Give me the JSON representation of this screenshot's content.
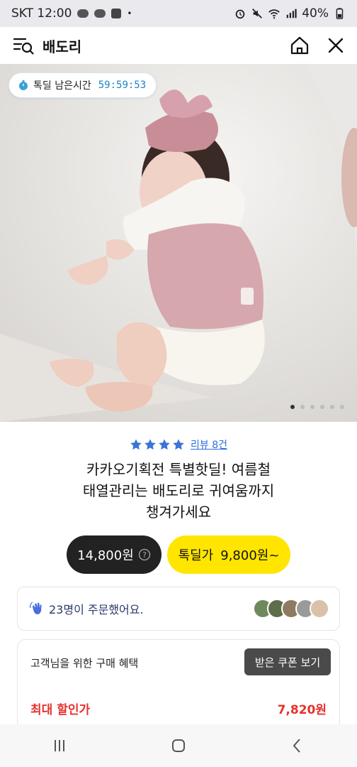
{
  "status_bar": {
    "carrier_time": "SKT 12:00",
    "battery": "40%"
  },
  "header": {
    "title": "배도리"
  },
  "hero": {
    "timer_label": "톡딜 남은시간",
    "timer_value": "59:59:53",
    "page_count": 6,
    "active_page": 1
  },
  "product": {
    "rating_stars": 4,
    "review_link": "리뷰 8건",
    "headline_line1": "카카오기획전 특별핫딜! 여름철",
    "headline_line2": "태열관리는 배도리로 귀여움까지",
    "headline_line3": "챙겨가세요",
    "normal_price": "14,800원",
    "deal_label": "톡딜가",
    "deal_price": "9,800원~"
  },
  "orders": {
    "text": "23명이 주문했어요."
  },
  "benefit": {
    "title": "고객님을 위한 구매 혜택",
    "coupon_button": "받은 쿠폰 보기",
    "max_label": "최대 할인가",
    "max_value": "7,820원"
  },
  "colors": {
    "accent_yellow": "#ffe500",
    "timer_blue": "#1a84c7",
    "link_blue": "#2f6fde",
    "discount_red": "#e5322d",
    "star_blue": "#3b74d8"
  }
}
